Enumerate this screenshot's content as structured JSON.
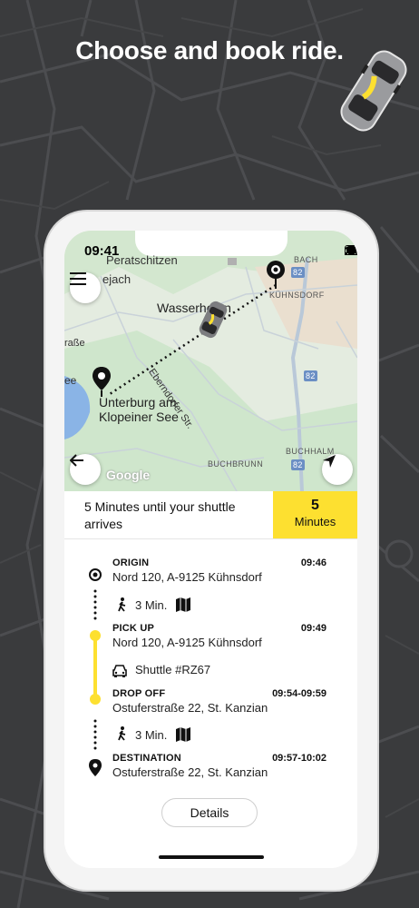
{
  "promo": {
    "headline": "Choose and book ride."
  },
  "status": {
    "time": "09:41"
  },
  "map": {
    "labels": {
      "peratschitzen": "Peratschitzen",
      "jach": "ejach",
      "bach": "BACH",
      "wasserhofen": "Wasserhofen",
      "kuhnsdorf": "KÜHNSDORF",
      "strasse_left": "raße",
      "eberndorfer": "Eberndorfer Str.",
      "see_partial": "ee",
      "unterburg1": "Unterburg am",
      "unterburg2": "Klopeiner See",
      "buchbrunn": "BUCHBRUNN",
      "buchhalm": "BUCHHALM",
      "route82a": "82",
      "route82b": "82",
      "route82c": "82",
      "google": "Google"
    }
  },
  "arrival": {
    "text": "5 Minutes until your shuttle arrives",
    "badge_value": "5",
    "badge_unit": "Minutes"
  },
  "trip": {
    "origin": {
      "title": "ORIGIN",
      "time": "09:46",
      "address": "Nord 120, A-9125 Kühnsdorf"
    },
    "walk1": {
      "label": "3 Min."
    },
    "pickup": {
      "title": "PICK UP",
      "time": "09:49",
      "address": "Nord 120, A-9125 Kühnsdorf"
    },
    "shuttle": {
      "label": "Shuttle #RZ67"
    },
    "dropoff": {
      "title": "DROP OFF",
      "time": "09:54-09:59",
      "address": "Ostuferstraße 22, St. Kanzian"
    },
    "walk2": {
      "label": "3 Min."
    },
    "destination": {
      "title": "DESTINATION",
      "time": "09:57-10:02",
      "address": "Ostuferstraße 22, St. Kanzian"
    }
  },
  "actions": {
    "details_label": "Details"
  },
  "colors": {
    "accent": "#fde030",
    "background": "#3a3b3d",
    "map_green": "#cfe6cc",
    "map_road": "#a9c4e4"
  }
}
